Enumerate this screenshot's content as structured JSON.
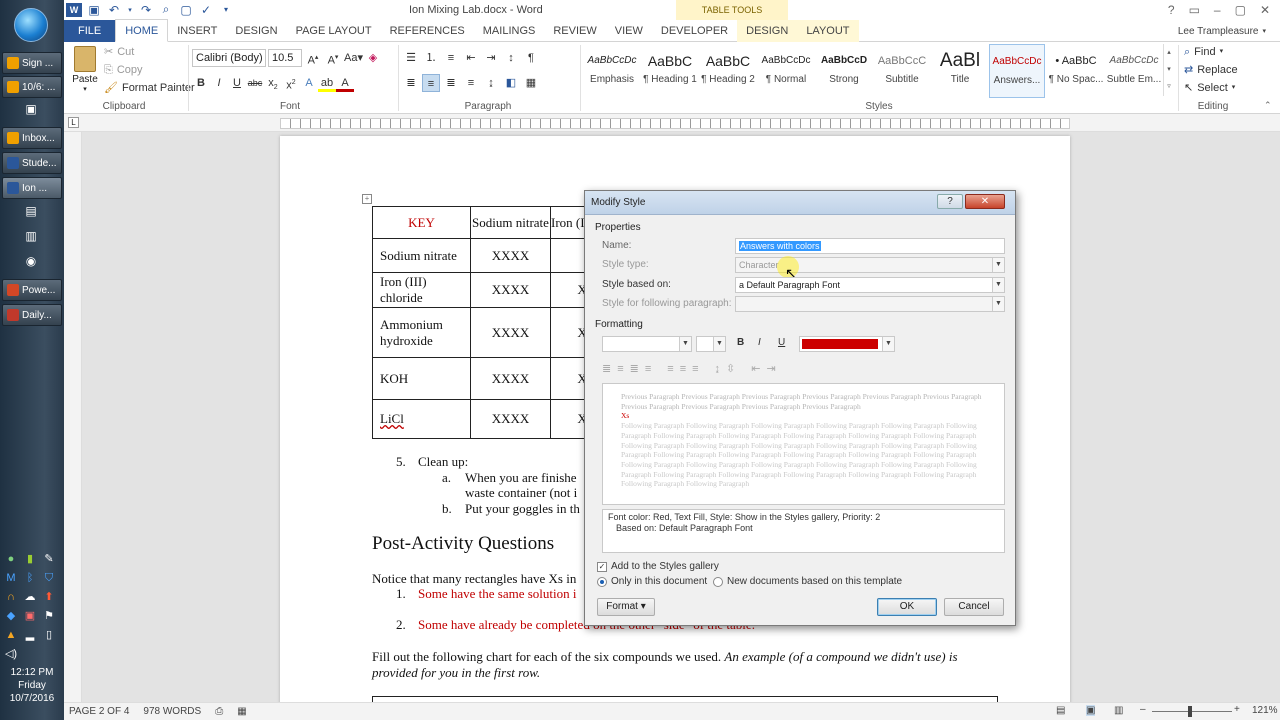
{
  "taskbar": {
    "items": [
      {
        "label": "Sign ...",
        "color": "#f0a000"
      },
      {
        "label": "10/6: ...",
        "color": "#f0a000"
      },
      {
        "label": "Inbox...",
        "color": "#f0a000"
      },
      {
        "label": "Stude...",
        "color": "#2b579a"
      },
      {
        "label": "Ion ...",
        "color": "#2b579a"
      },
      {
        "label": "Powe...",
        "color": "#d24726"
      },
      {
        "label": "Daily...",
        "color": "#c0392b"
      }
    ],
    "clock": {
      "time": "12:12 PM",
      "day": "Friday",
      "date": "10/7/2016"
    }
  },
  "title": "Ion Mixing Lab.docx - Word",
  "table_tools": "TABLE TOOLS",
  "user": "Lee Trampleasure",
  "tabs": [
    "FILE",
    "HOME",
    "INSERT",
    "DESIGN",
    "PAGE LAYOUT",
    "REFERENCES",
    "MAILINGS",
    "REVIEW",
    "VIEW",
    "DEVELOPER"
  ],
  "context_tabs": [
    "DESIGN",
    "LAYOUT"
  ],
  "ribbon": {
    "clipboard": {
      "paste": "Paste",
      "cut": "Cut",
      "copy": "Copy",
      "painter": "Format Painter",
      "label": "Clipboard"
    },
    "font": {
      "name": "Calibri (Body)",
      "size": "10.5",
      "label": "Font"
    },
    "paragraph": {
      "label": "Paragraph"
    },
    "styles": {
      "label": "Styles",
      "items": [
        {
          "preview": "AaBbCcDc",
          "name": "Emphasis"
        },
        {
          "preview": "AaBbC",
          "name": "¶ Heading 1"
        },
        {
          "preview": "AaBbC",
          "name": "¶ Heading 2"
        },
        {
          "preview": "AaBbCcDc",
          "name": "¶ Normal"
        },
        {
          "preview": "AaBbCcD",
          "name": "Strong"
        },
        {
          "preview": "AaBbCcC",
          "name": "Subtitle"
        },
        {
          "preview": "AaBl",
          "name": "Title"
        },
        {
          "preview": "AaBbCcDc",
          "name": "Answers..."
        },
        {
          "preview": "• AaBbC",
          "name": "¶ No Spac..."
        },
        {
          "preview": "AaBbCcDc",
          "name": "Subtle Em..."
        }
      ]
    },
    "editing": {
      "find": "Find",
      "replace": "Replace",
      "select": "Select",
      "label": "Editing"
    }
  },
  "document": {
    "table": {
      "header": [
        "KEY",
        "Sodium nitrate",
        "Iron (III) ch"
      ],
      "rows": [
        [
          "Sodium nitrate",
          "XXXX"
        ],
        [
          "Iron (III) chloride",
          "XXXX",
          "X"
        ],
        [
          "Ammonium hydroxide",
          "XXXX",
          "X"
        ],
        [
          "KOH",
          "XXXX",
          "X"
        ],
        [
          "LiCl",
          "XXXX",
          "X"
        ]
      ]
    },
    "step5_num": "5.",
    "step5": "Clean up:",
    "step5a_num": "a.",
    "step5a_1": "When you are finishe",
    "step5a_2": "waste container (not i",
    "step5b_num": "b.",
    "step5b": "Put your goggles in th",
    "heading": "Post-Activity Questions",
    "notice": "Notice that many rectangles have Xs in",
    "q1_num": "1.",
    "q1": "Some have the same solution i",
    "q2_num": "2.",
    "q2": "Some have already be completed on the other \"side\" of the table.",
    "fill_1": "Fill out the following chart for each of the six compounds we used.",
    "fill_1_italic": "An example (of a compound we didn't use) is",
    "fill_2": "provided for you in the first row."
  },
  "dialog": {
    "title": "Modify Style",
    "properties": "Properties",
    "name_label": "Name:",
    "name_value": "Answers with colors",
    "type_label": "Style type:",
    "type_value": "Character",
    "based_label": "Style based on:",
    "based_value": "a Default Paragraph Font",
    "following_label": "Style for following paragraph:",
    "formatting": "Formatting",
    "bold": "B",
    "italic": "I",
    "underline": "U",
    "font_color": "#cc0000",
    "preview_prev": "Previous Paragraph Previous Paragraph Previous Paragraph Previous Paragraph Previous Paragraph Previous Paragraph Previous Paragraph Previous Paragraph Previous Paragraph Previous Paragraph",
    "preview_sample": "Xs",
    "preview_follow": "Following Paragraph Following Paragraph Following Paragraph Following Paragraph Following Paragraph Following Paragraph Following Paragraph Following Paragraph Following Paragraph Following Paragraph Following Paragraph Following Paragraph Following Paragraph Following Paragraph Following Paragraph Following Paragraph Following Paragraph Following Paragraph Following Paragraph Following Paragraph Following Paragraph Following Paragraph Following Paragraph Following Paragraph Following Paragraph Following Paragraph Following Paragraph Following Paragraph Following Paragraph Following Paragraph Following Paragraph Following Paragraph Following Paragraph Following Paragraph Following Paragraph",
    "desc_1": "Font color: Red, Text Fill, Style: Show in the Styles gallery, Priority: 2",
    "desc_2": "Based on: Default Paragraph Font",
    "add_gallery": "Add to the Styles gallery",
    "only_doc": "Only in this document",
    "new_docs": "New documents based on this template",
    "format_btn": "Format ▾",
    "ok": "OK",
    "cancel": "Cancel"
  },
  "status": {
    "page": "PAGE 2 OF 4",
    "words": "978 WORDS",
    "zoom": "121%"
  }
}
